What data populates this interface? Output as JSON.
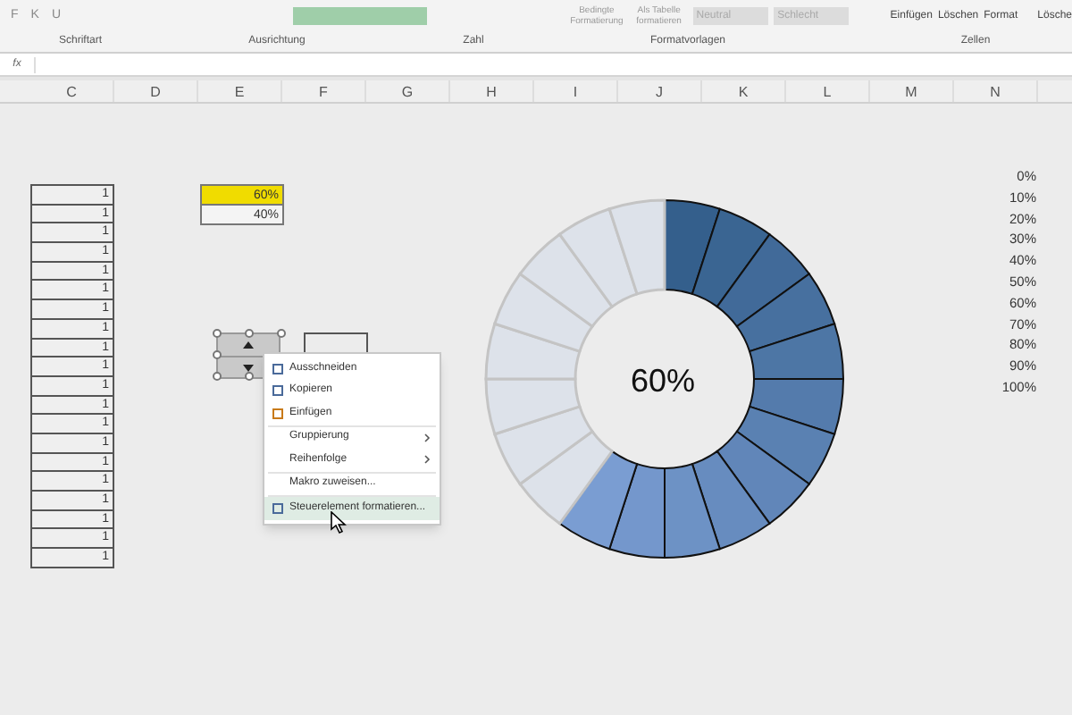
{
  "ribbon": {
    "font_buttons": [
      "F",
      "K",
      "U"
    ],
    "styles_buttons": [
      {
        "label": "Bedingte Formatierung"
      },
      {
        "label": "Als Tabelle formatieren"
      }
    ],
    "style_cells": [
      {
        "label": "Neutral"
      },
      {
        "label": "Schlecht"
      }
    ],
    "cells_buttons": [
      "Einfügen",
      "Löschen",
      "Format"
    ],
    "cut_button": "Lösche",
    "groups": [
      "Schriftart",
      "Ausrichtung",
      "Zahl",
      "Formatvorlagen",
      "Zellen"
    ]
  },
  "formula_bar": {
    "fx": "fx"
  },
  "columns": [
    "C",
    "D",
    "E",
    "F",
    "G",
    "H",
    "I",
    "J",
    "K",
    "L",
    "M",
    "N"
  ],
  "column_c": [
    "1",
    "1",
    "1",
    "1",
    "1",
    "1",
    "1",
    "1",
    "1",
    "1",
    "1",
    "1",
    "1",
    "1",
    "1",
    "1",
    "1",
    "1",
    "1",
    "1"
  ],
  "column_e": [
    {
      "text": "60%",
      "highlighted": true
    },
    {
      "text": "40%",
      "highlighted": false
    }
  ],
  "percent_list": [
    "0%",
    "10%",
    "20%",
    "30%",
    "40%",
    "50%",
    "60%",
    "70%",
    "80%",
    "90%",
    "100%"
  ],
  "donut": {
    "level": 0.6,
    "label": "60%"
  },
  "context_menu": [
    {
      "label": "Ausschneiden",
      "kind": "icon",
      "submenu": false,
      "selected": false
    },
    {
      "label": "Kopieren",
      "kind": "icon",
      "submenu": false,
      "selected": false
    },
    {
      "label": "Einfügen",
      "kind": "icon",
      "submenu": false,
      "selected": false
    },
    {
      "label": "Gruppierung",
      "kind": "plain",
      "submenu": true,
      "selected": false
    },
    {
      "label": "Reihenfolge",
      "kind": "plain",
      "submenu": true,
      "selected": false
    },
    {
      "label": "Makro zuweisen...",
      "kind": "plain",
      "submenu": false,
      "selected": false
    },
    {
      "label": "Steuerelement formatieren...",
      "kind": "icon",
      "submenu": false,
      "selected": true
    }
  ]
}
